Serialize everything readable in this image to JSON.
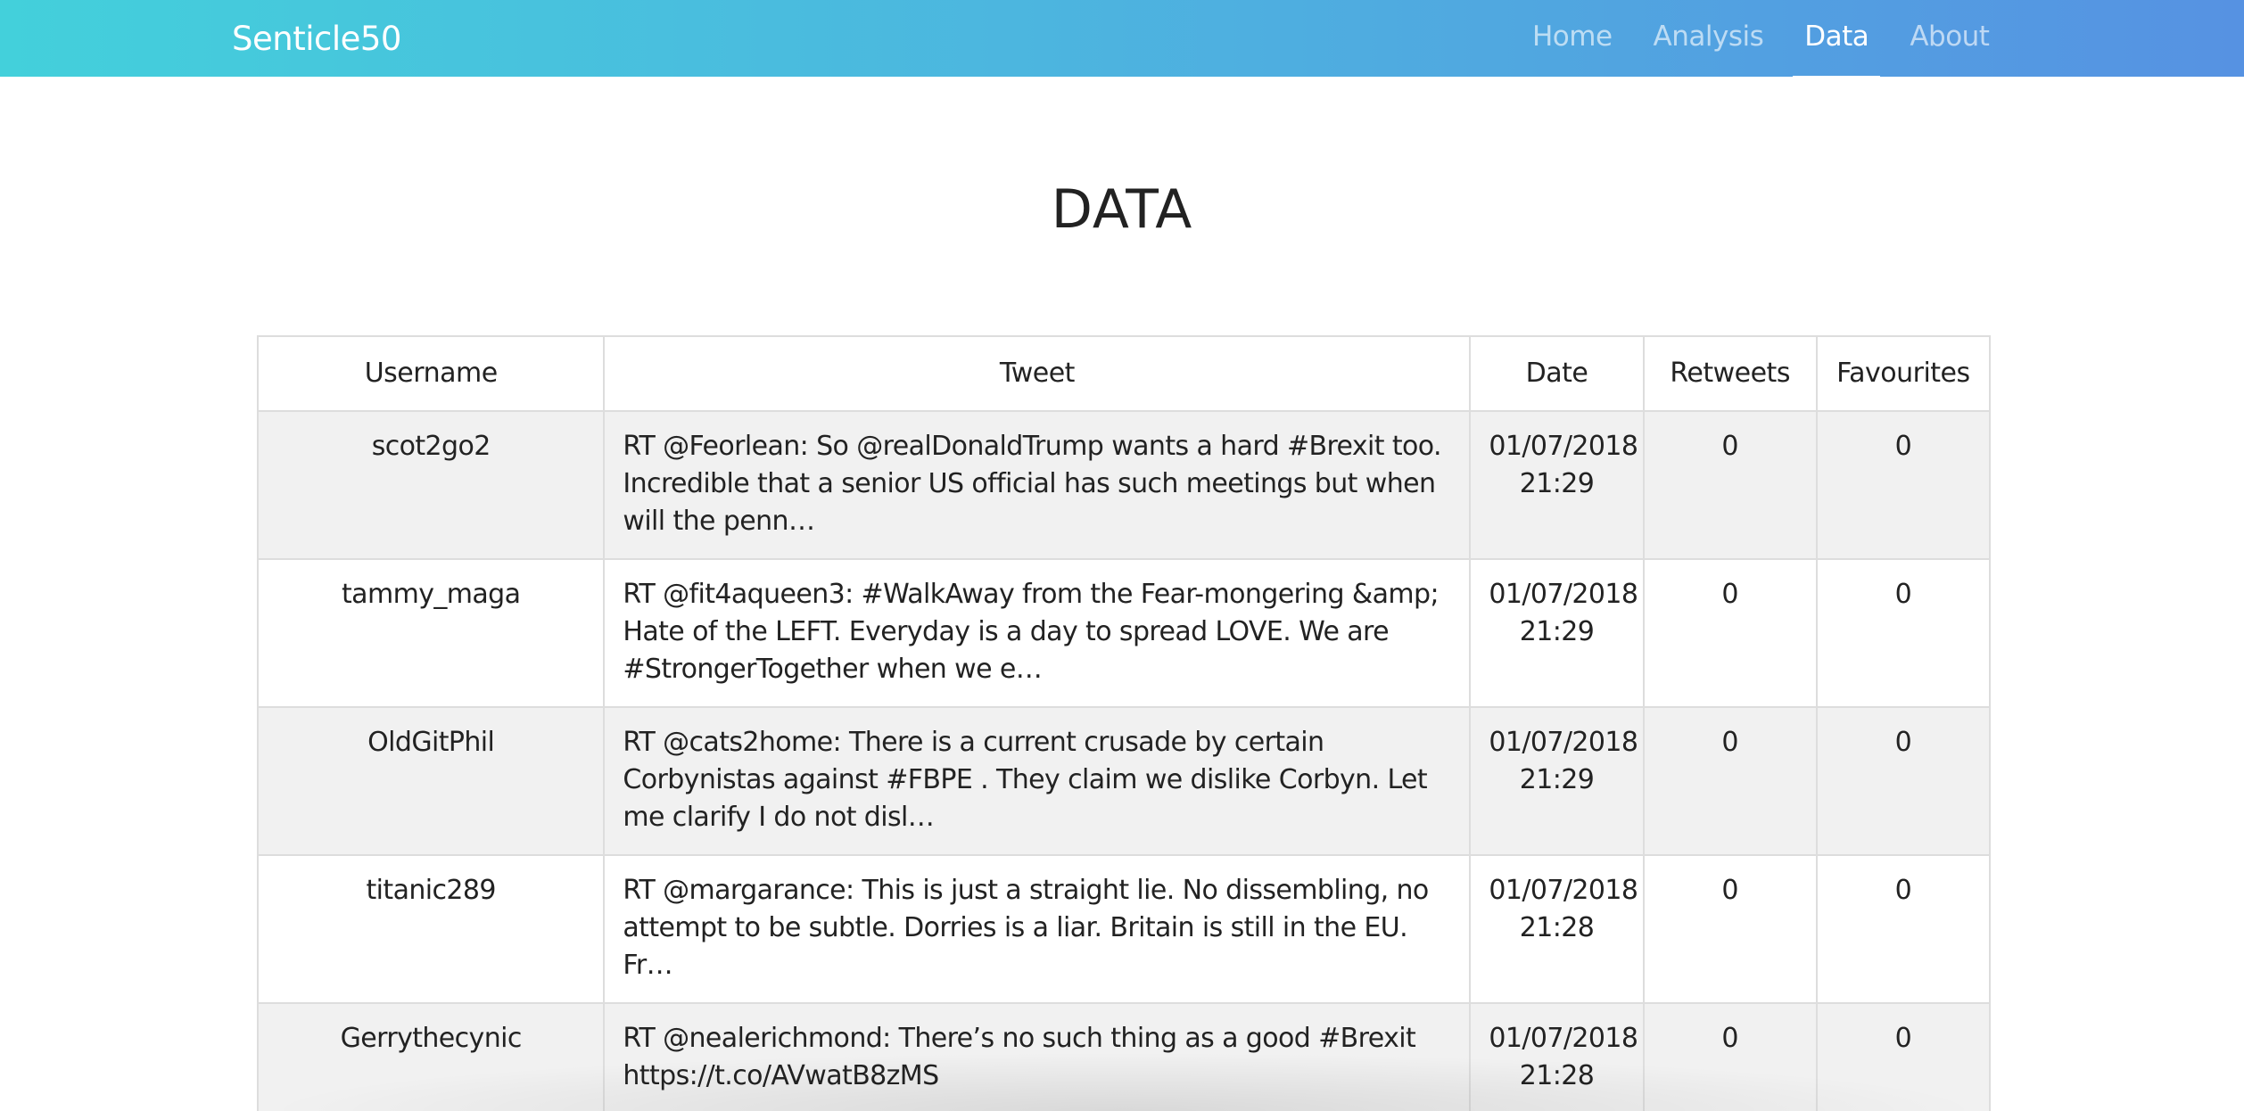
{
  "navbar": {
    "brand": "Senticle50",
    "links": [
      {
        "label": "Home"
      },
      {
        "label": "Analysis"
      },
      {
        "label": "Data"
      },
      {
        "label": "About"
      }
    ],
    "active": "Data"
  },
  "page": {
    "title": "DATA"
  },
  "table": {
    "headers": [
      "Username",
      "Tweet",
      "Date",
      "Retweets",
      "Favourites"
    ],
    "rows": [
      {
        "username": "scot2go2",
        "tweet": "RT @Feorlean: So @realDonaldTrump wants a hard #Brexit too. Incredible that a senior US official has such meetings but when will the penn…",
        "date": "01/07/2018 21:29",
        "retweets": "0",
        "favourites": "0"
      },
      {
        "username": "tammy_maga",
        "tweet": "RT @fit4aqueen3: #WalkAway from the Fear-mongering &amp; Hate of the LEFT. Everyday is a day to spread LOVE. We are #StrongerTogether when we e…",
        "date": "01/07/2018 21:29",
        "retweets": "0",
        "favourites": "0"
      },
      {
        "username": "OldGitPhil",
        "tweet": "RT @cats2home: There is a current crusade by certain Corbynistas against #FBPE . They claim we dislike Corbyn. Let me clarify I do not disl…",
        "date": "01/07/2018 21:29",
        "retweets": "0",
        "favourites": "0"
      },
      {
        "username": "titanic289",
        "tweet": "RT @margarance: This is just a straight lie. No dissembling, no attempt to be subtle. Dorries is a liar. Britain is still in the EU. Fr…",
        "date": "01/07/2018 21:28",
        "retweets": "0",
        "favourites": "0"
      },
      {
        "username": "Gerrythecynic",
        "tweet": "RT @nealerichmond: There’s no such thing as a good #Brexit https://t.co/AVwatB8zMS",
        "date": "01/07/2018 21:28",
        "retweets": "0",
        "favourites": "0"
      },
      {
        "username": "",
        "tweet": "",
        "date": "",
        "retweets": "",
        "favourites": ""
      }
    ]
  }
}
